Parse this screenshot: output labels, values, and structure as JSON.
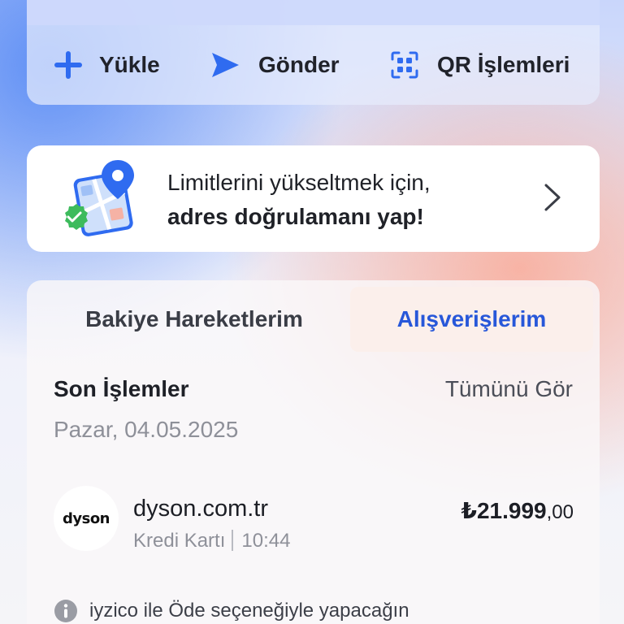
{
  "actions": {
    "load_label": "Yükle",
    "send_label": "Gönder",
    "qr_label": "QR İşlemleri"
  },
  "banner": {
    "line1": "Limitlerini yükseltmek için,",
    "line2": "adres doğrulamanı yap!"
  },
  "tabs": [
    {
      "label": "Bakiye Hareketlerim",
      "active": false
    },
    {
      "label": "Alışverişlerim",
      "active": true
    }
  ],
  "recent": {
    "title": "Son İşlemler",
    "see_all": "Tümünü Gör",
    "date": "Pazar, 04.05.2025"
  },
  "transaction": {
    "logo_text": "dyson",
    "merchant": "dyson.com.tr",
    "method": "Kredi Kartı",
    "time": "10:44",
    "amount_main": "₺21.999",
    "amount_decimal": ",00"
  },
  "note": {
    "text": "iyzico ile Öde seçeneğiyle yapacağın"
  },
  "colors": {
    "accent": "#2757d9",
    "icon_blue": "#2f6bf0",
    "verified_green": "#3dbb5c"
  },
  "icons": {
    "load": "plus-icon",
    "send": "send-icon",
    "qr": "qr-scan-icon",
    "banner": "map-pin-illustration",
    "chevron": "chevron-right-icon",
    "info": "info-icon"
  }
}
